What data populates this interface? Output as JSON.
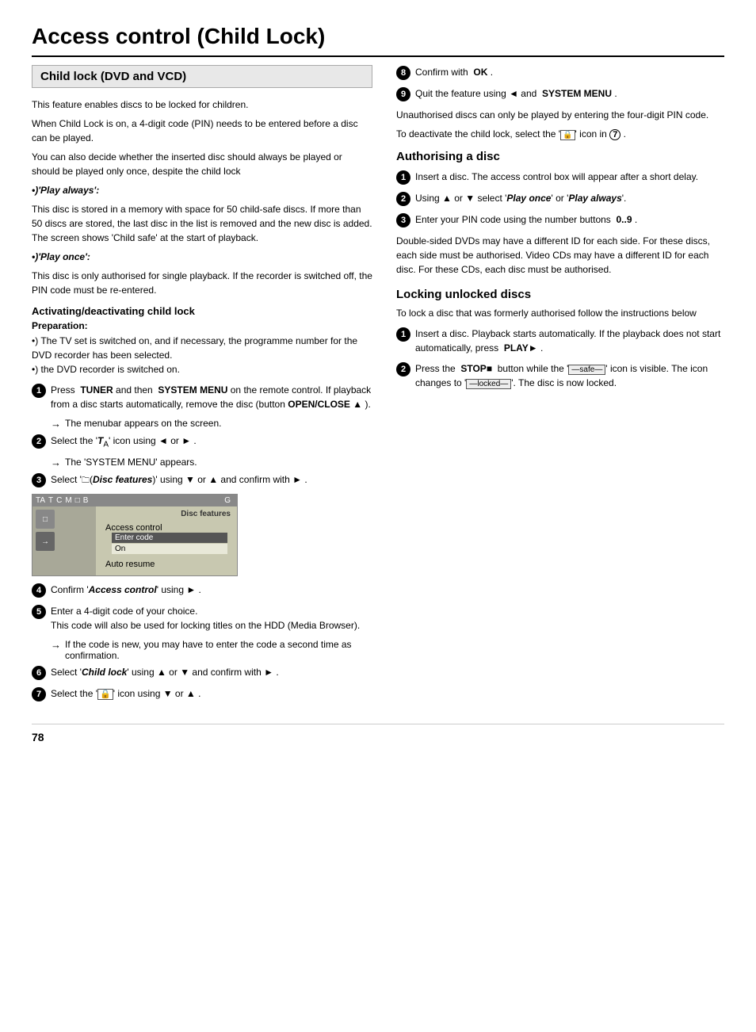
{
  "page": {
    "title": "Access control (Child Lock)",
    "page_number": "78"
  },
  "left": {
    "section_title": "Child lock (DVD and VCD)",
    "intro": [
      "This feature enables discs to be locked for children.",
      "When Child Lock is on, a 4-digit code (PIN) needs to be entered before a disc can be played.",
      "You can also decide whether the inserted disc should always be played or should be played only once, despite the child lock"
    ],
    "play_always_label": "•)'Play always':",
    "play_always_text": "This disc is stored in a memory with space for 50 child-safe discs. If more than 50 discs are stored, the last disc in the list is removed and the new disc is added. The screen shows 'Child safe' at the start of playback.",
    "play_once_label": "•)'Play once':",
    "play_once_text": "This disc is only authorised for single playback. If the recorder is switched off, the PIN code must be re-entered.",
    "activating_title": "Activating/deactivating child lock",
    "prep_label": "Preparation:",
    "prep_items": [
      "•) The TV set is switched on, and if necessary, the programme number for the DVD recorder has been selected.",
      "•) the DVD recorder is switched on."
    ],
    "steps": [
      {
        "num": "1",
        "text": "Press  TUNER and then  SYSTEM MENU on the remote control. If playback from a disc starts automatically, remove the disc (button OPEN/CLOSE ▲ ).",
        "arrow": "The menubar appears on the screen."
      },
      {
        "num": "2",
        "text": "Select the 'TA' icon using ◄ or ► .",
        "arrow": "The 'SYSTEM MENU' appears."
      },
      {
        "num": "3",
        "text": "Select '(Disc features)' using ▼ or ▲ and confirm with ► ."
      },
      {
        "num": "4",
        "text": "Confirm 'Access control' using ► ."
      },
      {
        "num": "5",
        "text": "Enter a 4-digit code of your choice.",
        "sub_text": "This code will also be used for locking titles on the HDD (Media Browser).",
        "arrow": "If the code is new, you may have to enter the code a second time as confirmation."
      },
      {
        "num": "6",
        "text": "Select 'Child lock' using ▲ or ▼ and confirm with ► ."
      },
      {
        "num": "7",
        "text": "Select the '🔒' icon using ▼ or ▲ ."
      }
    ],
    "menu": {
      "top_icons": [
        "TA",
        "T",
        "C",
        "M",
        "□",
        "B",
        "G"
      ],
      "left_icons": [
        "□",
        "→"
      ],
      "right_title": "Disc features",
      "items": [
        {
          "label": "Access control",
          "selected": false
        },
        {
          "label": "Auto resume",
          "selected": false
        }
      ],
      "sub_items": [
        {
          "label": "Enter code",
          "highlighted": true
        },
        {
          "label": "On",
          "highlighted": false
        }
      ]
    }
  },
  "right": {
    "steps_cont": [
      {
        "num": "8",
        "text": "Confirm with  OK ."
      },
      {
        "num": "9",
        "text": "Quit the feature using ◄ and  SYSTEM MENU ."
      }
    ],
    "notes": [
      "Unauthorised discs can only be played by entering the four-digit PIN code.",
      "To deactivate the child lock, select the '🔒' icon in 7 ."
    ],
    "authorising_title": "Authorising a disc",
    "auth_steps": [
      {
        "num": "1",
        "text": "Insert a disc. The access control box will appear after a short delay."
      },
      {
        "num": "2",
        "text": "Using ▲ or ▼ select 'Play once' or 'Play always'."
      },
      {
        "num": "3",
        "text": "Enter your PIN code using the number buttons  0..9 ."
      }
    ],
    "auth_note": "Double-sided DVDs may have a different ID for each side. For these discs, each side must be authorised. Video CDs may have a different ID for each disc. For these CDs, each disc must be authorised.",
    "locking_title": "Locking unlocked discs",
    "locking_intro": "To lock a disc that was formerly authorised follow the instructions below",
    "locking_steps": [
      {
        "num": "1",
        "text": "Insert a disc. Playback starts automatically. If the playback does not start automatically, press  PLAY► ."
      },
      {
        "num": "2",
        "text": "Press the  STOP■  button while the '—safe—' icon is visible. The icon changes to '—locked—'. The disc is now locked."
      }
    ]
  }
}
